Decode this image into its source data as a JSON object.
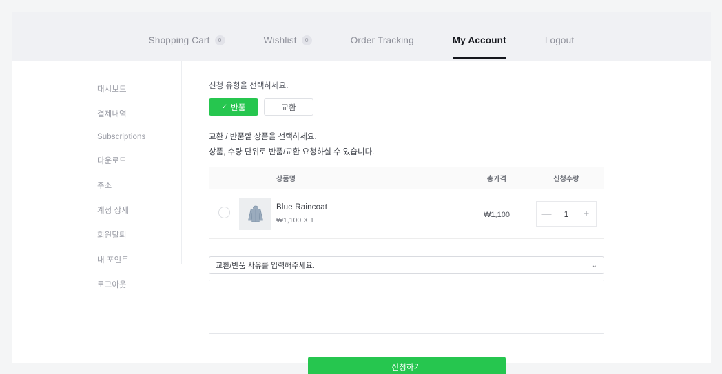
{
  "nav": {
    "items": [
      {
        "label": "Shopping Cart",
        "badge": "0",
        "active": false
      },
      {
        "label": "Wishlist",
        "badge": "0",
        "active": false
      },
      {
        "label": "Order Tracking",
        "badge": null,
        "active": false
      },
      {
        "label": "My Account",
        "badge": null,
        "active": true
      },
      {
        "label": "Logout",
        "badge": null,
        "active": false
      }
    ]
  },
  "sidebar": {
    "items": [
      {
        "label": "대시보드"
      },
      {
        "label": "결제내역"
      },
      {
        "label": "Subscriptions"
      },
      {
        "label": "다운로드"
      },
      {
        "label": "주소"
      },
      {
        "label": "계정 상세"
      },
      {
        "label": "회원탈퇴"
      },
      {
        "label": "내 포인트"
      },
      {
        "label": "로그아웃"
      }
    ]
  },
  "main": {
    "type_prompt": "신청 유형을 선택하세요.",
    "type_options": [
      {
        "label": "반품",
        "selected": true,
        "check": "✓"
      },
      {
        "label": "교환",
        "selected": false
      }
    ],
    "select_prompt_1": "교환 / 반품할 상품을 선택하세요.",
    "select_prompt_2": "상품, 수량 단위로 반품/교환 요청하실 수 있습니다.",
    "table": {
      "headers": [
        "",
        "",
        "상품명",
        "총가격",
        "신청수량"
      ],
      "rows": [
        {
          "selected": false,
          "thumb_alt": "blue-raincoat-thumbnail",
          "name": "Blue Raincoat",
          "meta": "₩1,100 X 1",
          "price": "₩1,100",
          "qty": "1",
          "minus": "—",
          "plus": "+"
        }
      ]
    },
    "reason_select": {
      "value": "교환/반품 사유를 입력해주세요.",
      "chevron": "⌄"
    },
    "reason_textarea": {
      "value": "",
      "placeholder": ""
    },
    "submit_label": "신청하기"
  },
  "colors": {
    "accent_green": "#26c64f",
    "page_bg": "#f4f5f6",
    "nav_bg": "#f0f1f4",
    "card_bg": "#ffffff"
  }
}
